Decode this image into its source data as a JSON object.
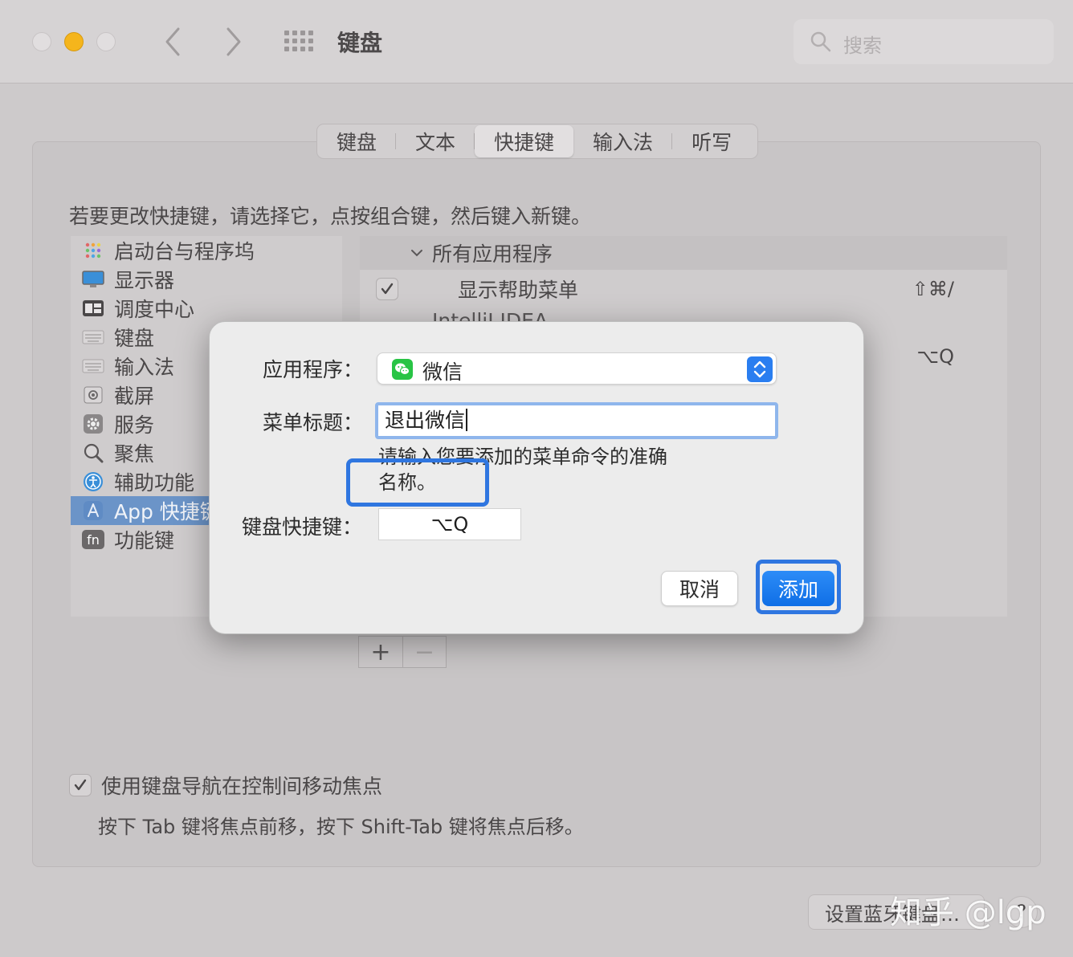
{
  "window": {
    "title": "键盘",
    "search_placeholder": "搜索"
  },
  "tabs": [
    {
      "label": "键盘"
    },
    {
      "label": "文本"
    },
    {
      "label": "快捷键",
      "active": true
    },
    {
      "label": "输入法"
    },
    {
      "label": "听写"
    }
  ],
  "instruction": "若要更改快捷键，请选择它，点按组合键，然后键入新键。",
  "sidebar": {
    "items": [
      {
        "label": "启动台与程序坞",
        "icon": "launchpad-icon"
      },
      {
        "label": "显示器",
        "icon": "display-icon"
      },
      {
        "label": "调度中心",
        "icon": "mission-control-icon"
      },
      {
        "label": "键盘",
        "icon": "keyboard-icon"
      },
      {
        "label": "输入法",
        "icon": "input-method-icon"
      },
      {
        "label": "截屏",
        "icon": "screenshot-icon"
      },
      {
        "label": "服务",
        "icon": "gear-icon"
      },
      {
        "label": "聚焦",
        "icon": "spotlight-icon"
      },
      {
        "label": "辅助功能",
        "icon": "accessibility-icon"
      },
      {
        "label": "App 快捷键",
        "icon": "app-store-icon",
        "selected": true
      },
      {
        "label": "功能键",
        "icon": "fn-key-icon"
      }
    ]
  },
  "shortcuts": {
    "group_label": "所有应用程序",
    "rows": [
      {
        "label": "显示帮助菜单",
        "key": "⇧⌘/",
        "checked": true
      }
    ],
    "partial_row_label": "IntelliJ IDEA",
    "partial_row_key": "⌥Q",
    "add_symbol": "+",
    "remove_symbol": "−"
  },
  "keyboard_nav": {
    "label": "使用键盘导航在控制间移动焦点",
    "checked": true,
    "description": "按下 Tab 键将焦点前移，按下 Shift-Tab 键将焦点后移。"
  },
  "bluetooth_button": "设置蓝牙键盘…",
  "help_button": "?",
  "watermark": "知乎 @lgp",
  "dialog": {
    "app_label": "应用程序：",
    "app_value": "微信",
    "menu_title_label": "菜单标题：",
    "menu_title_value": "退出微信",
    "hint": "请输入您要添加的菜单命令的准确名称。",
    "shortcut_label": "键盘快捷键：",
    "shortcut_value": "⌥Q",
    "cancel_label": "取消",
    "add_label": "添加"
  },
  "colors": {
    "accent": "#2f76e0",
    "wechat": "#28c445",
    "selected_row": "#6b94c8"
  }
}
